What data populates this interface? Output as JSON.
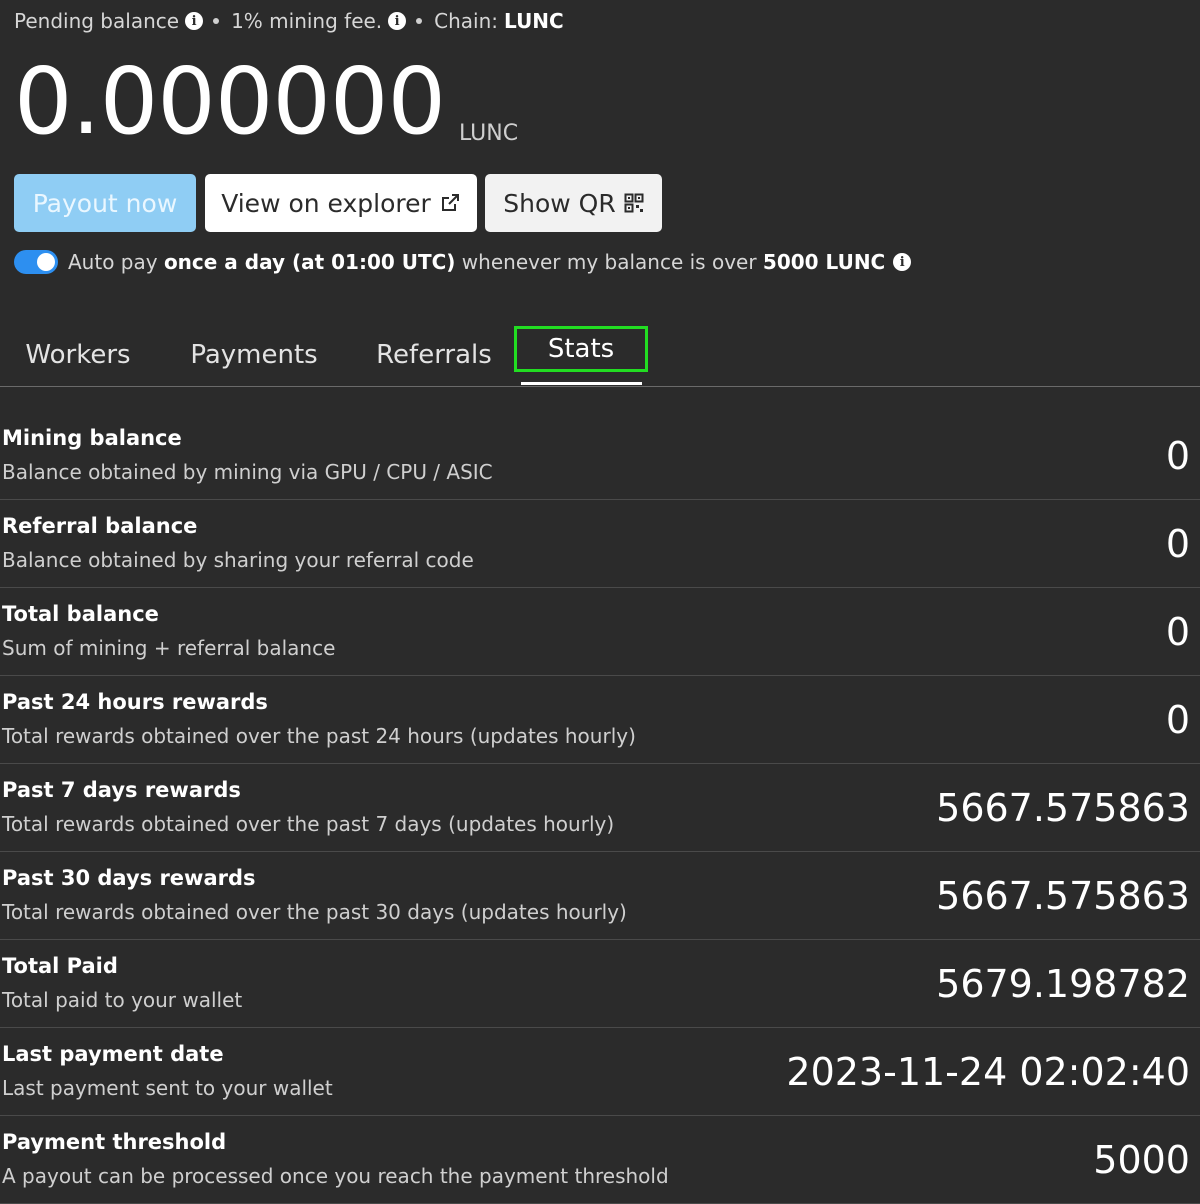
{
  "header": {
    "pending_label": "Pending balance",
    "fee_label": "1% mining fee.",
    "chain_label": "Chain:",
    "chain_value": "LUNC"
  },
  "balance": {
    "value": "0.000000",
    "unit": "LUNC"
  },
  "buttons": {
    "payout": "Payout now",
    "explorer": "View on explorer",
    "show_qr": "Show QR"
  },
  "autopay": {
    "enabled": true,
    "part1": "Auto pay ",
    "part2": "once a day (at 01:00 UTC)",
    "part3": " whenever my balance is over ",
    "part4": "5000 LUNC"
  },
  "tabs": [
    {
      "label": "Workers"
    },
    {
      "label": "Payments"
    },
    {
      "label": "Referrals"
    },
    {
      "label": "Stats",
      "active": true
    }
  ],
  "stats": [
    {
      "title": "Mining balance",
      "desc": "Balance obtained by mining via GPU / CPU / ASIC",
      "value": "0"
    },
    {
      "title": "Referral balance",
      "desc": "Balance obtained by sharing your referral code",
      "value": "0"
    },
    {
      "title": "Total balance",
      "desc": "Sum of mining + referral balance",
      "value": "0"
    },
    {
      "title": "Past 24 hours rewards",
      "desc": "Total rewards obtained over the past 24 hours (updates hourly)",
      "value": "0"
    },
    {
      "title": "Past 7 days rewards",
      "desc": "Total rewards obtained over the past 7 days (updates hourly)",
      "value": "5667.575863"
    },
    {
      "title": "Past 30 days rewards",
      "desc": "Total rewards obtained over the past 30 days (updates hourly)",
      "value": "5667.575863"
    },
    {
      "title": "Total Paid",
      "desc": "Total paid to your wallet",
      "value": "5679.198782"
    },
    {
      "title": "Last payment date",
      "desc": "Last payment sent to your wallet",
      "value": "2023-11-24 02:02:40"
    },
    {
      "title": "Payment threshold",
      "desc": "A payout can be processed once you reach the payment threshold",
      "value": "5000"
    }
  ],
  "colors": {
    "background": "#2b2b2b",
    "payout_button": "#8fcdf4",
    "toggle_on": "#2d8ff0",
    "active_tab_outline": "#22dd22"
  }
}
